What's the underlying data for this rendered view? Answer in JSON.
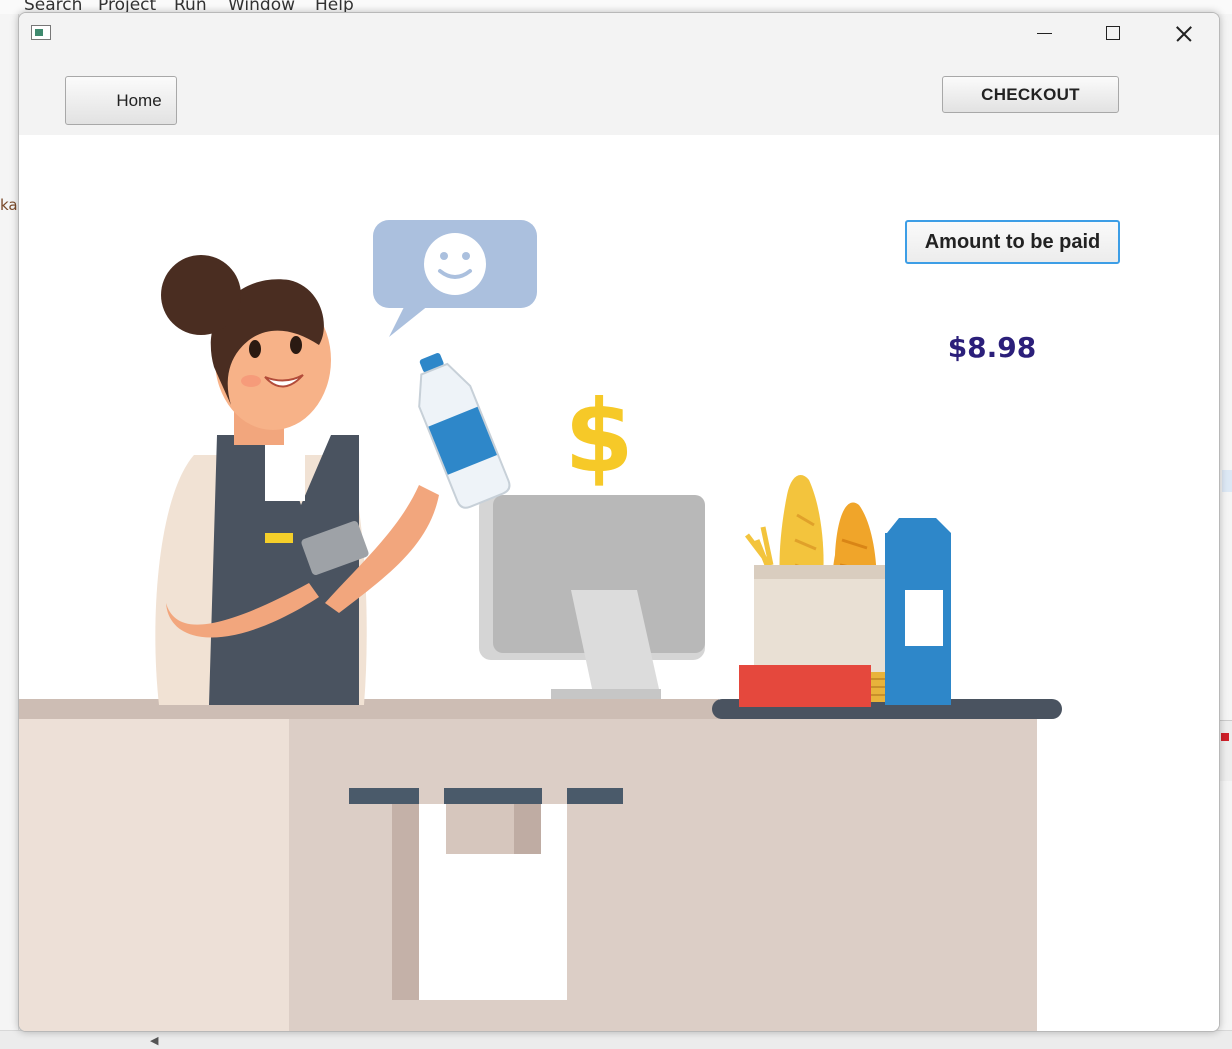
{
  "ide": {
    "menu": [
      "Search",
      "Project",
      "Run",
      "Window",
      "Help"
    ],
    "left_fragment": "ka"
  },
  "window": {
    "icon": "app-window-icon",
    "controls": [
      "minimize-icon",
      "maximize-icon",
      "close-icon"
    ]
  },
  "toolbar": {
    "home_label": "Home",
    "checkout_label": "CHECKOUT"
  },
  "payment": {
    "amount_button_label": "Amount to be paid",
    "amount_value": "$8.98"
  },
  "illustration": {
    "name": "cashier-checkout-illustration",
    "dollar_sign": "$"
  },
  "colors": {
    "accent_border": "#3d9ee6",
    "amount_text": "#2b1f7a"
  }
}
